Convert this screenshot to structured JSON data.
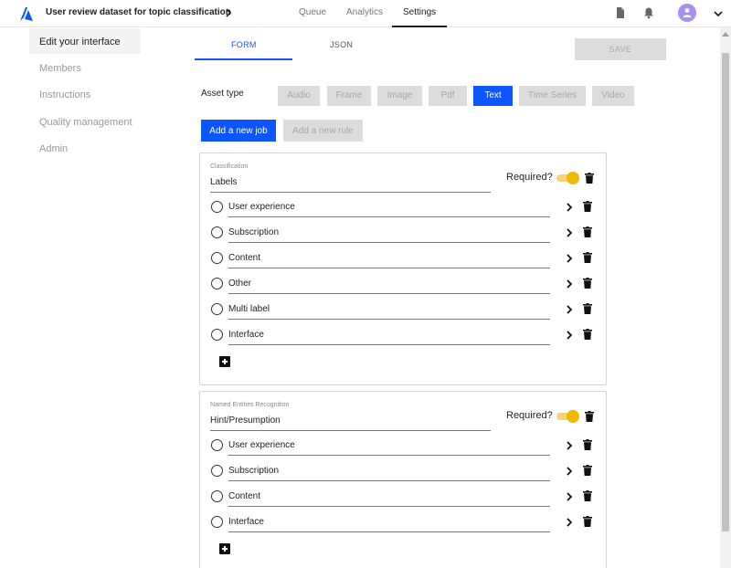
{
  "header": {
    "project_title": "User review dataset for topic classification",
    "nav": [
      "Queue",
      "Analytics",
      "Settings"
    ],
    "active_nav": "Settings"
  },
  "sidebar": {
    "items": [
      {
        "label": "Edit your interface"
      },
      {
        "label": "Members"
      },
      {
        "label": "Instructions"
      },
      {
        "label": "Quality management"
      },
      {
        "label": "Admin"
      }
    ],
    "active": "Edit your interface"
  },
  "editor": {
    "tabs": [
      "FORM",
      "JSON"
    ],
    "active_tab": "FORM",
    "save_label": "SAVE",
    "asset_type_label": "Asset type",
    "asset_types": [
      "Audio",
      "Frame",
      "Image",
      "Pdf",
      "Text",
      "Time Series",
      "Video"
    ],
    "active_asset_type": "Text",
    "add_job_label": "Add a new job",
    "add_rule_label": "Add a new rule"
  },
  "jobs": [
    {
      "type": "Classification",
      "name": "Labels",
      "required_label": "Required?",
      "required": true,
      "options": [
        "User experience",
        "Subscription",
        "Content",
        "Other",
        "Multi label",
        "Interface"
      ]
    },
    {
      "type": "Named Entities Recognition",
      "name": "Hint/Presumption",
      "required_label": "Required?",
      "required": true,
      "options": [
        "User experience",
        "Subscription",
        "Content",
        "Interface"
      ]
    }
  ],
  "colors": {
    "accent": "#0d56ff",
    "toggle_on": "#f0b800",
    "avatar": "#a98ef4",
    "disabled": "#dcdcdc"
  },
  "icons": {
    "logo": "kili-logo-icon",
    "document": "document-icon",
    "notifications": "bell-icon",
    "avatar": "user-icon",
    "menu": "chevron-down-icon"
  }
}
